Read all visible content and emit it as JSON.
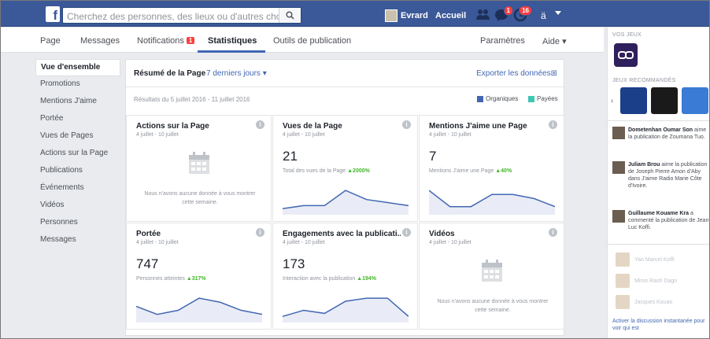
{
  "topbar": {
    "search_placeholder": "Cherchez des personnes, des lieux ou d'autres choses",
    "user_name": "Evrard",
    "home_label": "Accueil",
    "friend_requests_badge": "",
    "messages_badge": "1",
    "notifications_badge": "16",
    "help_label": "ä",
    "colors": {
      "bar": "#3b5998",
      "accent": "#4267b2"
    }
  },
  "pagenav": {
    "items": [
      {
        "label": "Page"
      },
      {
        "label": "Messages"
      },
      {
        "label": "Notifications",
        "badge": "1"
      },
      {
        "label": "Statistiques",
        "active": true
      },
      {
        "label": "Outils de publication"
      }
    ],
    "settings_label": "Paramètres",
    "help_label": "Aide ▾"
  },
  "leftmenu": {
    "items": [
      "Vue d'ensemble",
      "Promotions",
      "Mentions J'aime",
      "Portée",
      "Vues de Pages",
      "Actions sur la Page",
      "Publications",
      "Événements",
      "Vidéos",
      "Personnes",
      "Messages"
    ]
  },
  "summary": {
    "title": "Résumé de la Page",
    "period": "7 derniers jours ▾",
    "export": "Exporter les données⊞",
    "results": "Résultats du 5 juillet 2016 - 11 juillet 2016",
    "legend_organic": "Organiques",
    "legend_paid": "Payées",
    "color_organic": "#4267b2",
    "color_paid": "#3fc7b1"
  },
  "cards": [
    {
      "title": "Actions sur la Page",
      "date": "4 juillet - 10 juillet",
      "empty": "Nous n'avons aucune donnée à vous montrer cette semaine."
    },
    {
      "title": "Vues de la Page",
      "date": "4 juillet - 10 juillet",
      "value": "21",
      "sub": "Total des vues de la Page",
      "pct": "▲2000%",
      "trend": [
        2,
        3,
        3,
        8,
        5,
        4,
        3
      ]
    },
    {
      "title": "Mentions J'aime une Page",
      "date": "4 juillet - 10 juillet",
      "value": "7",
      "sub": "Mentions J'aime une Page",
      "pct": "▲40%",
      "trend": [
        6,
        2,
        2,
        5,
        5,
        4,
        2
      ]
    },
    {
      "title": "Portée",
      "date": "4 juillet - 10 juillet",
      "value": "747",
      "sub": "Personnes atteintes",
      "pct": "▲317%",
      "trend": [
        4,
        2,
        3,
        6,
        5,
        3,
        2
      ]
    },
    {
      "title": "Engagements avec la publicati...",
      "date": "4 juillet - 10 juillet",
      "value": "173",
      "sub": "Interaction avec la publication",
      "pct": "▲194%",
      "trend": [
        2,
        4,
        3,
        7,
        8,
        8,
        2
      ]
    },
    {
      "title": "Vidéos",
      "date": "4 juillet - 10 juillet",
      "empty": "Nous n'avons aucune donnée à vous montrer cette semaine."
    }
  ],
  "rightside": {
    "your_games": "VOS JEUX",
    "recommended_games": "JEUX RECOMMANDÉS",
    "ticker": [
      {
        "name": "Dometenhan Oumar Son",
        "text": "aime la publication de Zoumana Tuo."
      },
      {
        "name": "Juliam Brou",
        "text": "aime la publication de Joseph Pierre Amon d'Aby dans J'aime Radio Marie Côte d'Ivoire."
      },
      {
        "name": "Guillaume Kouame Kra",
        "text": "a commenté la publication de Jean-Luc Koffi."
      }
    ],
    "chat": [
      {
        "name": "Yao Marcel Koffi"
      },
      {
        "name": "Mimo Rash Dago"
      },
      {
        "name": "Jacques Kouao"
      }
    ],
    "chat_footer": "Activer la discussion instantanée pour voir qui est"
  }
}
